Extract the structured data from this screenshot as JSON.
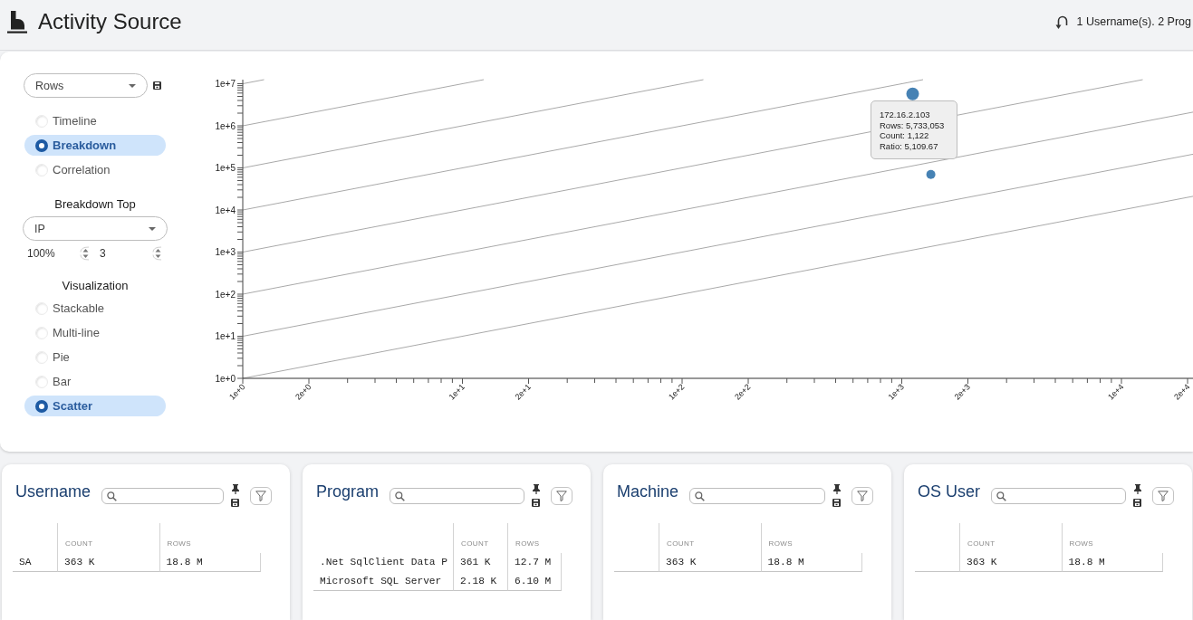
{
  "header": {
    "title": "Activity Source",
    "summary": "1 Username(s). 2 Prog"
  },
  "controls": {
    "metric_dropdown": {
      "value": "Rows"
    },
    "modes": [
      {
        "label": "Timeline",
        "selected": false
      },
      {
        "label": "Breakdown",
        "selected": true
      },
      {
        "label": "Correlation",
        "selected": false
      }
    ],
    "breakdown_top": {
      "label": "Breakdown Top",
      "dropdown_value": "IP",
      "percent": "100%",
      "count": "3"
    },
    "visualization": {
      "label": "Visualization",
      "options": [
        {
          "label": "Stackable",
          "selected": false
        },
        {
          "label": "Multi-line",
          "selected": false
        },
        {
          "label": "Pie",
          "selected": false
        },
        {
          "label": "Bar",
          "selected": false
        },
        {
          "label": "Scatter",
          "selected": true
        }
      ]
    }
  },
  "scatter_chart": {
    "y_axis": {
      "labels": [
        "1e+7",
        "1e+6",
        "1e+5",
        "1e+4",
        "1e+3",
        "1e+2",
        "1e+1",
        "1e+0"
      ]
    },
    "x_axis": {
      "labels": [
        "1e+0",
        "2e+0",
        "1e+1",
        "2e+1",
        "1e+2",
        "2e+2",
        "1e+3",
        "2e+3",
        "1e+4",
        "2e+4"
      ]
    },
    "points": [
      {
        "hovered": true
      },
      {
        "hovered": false
      }
    ],
    "tooltip": {
      "lines": [
        "172.16.2.103",
        "Rows: 5,733,053",
        "Count: 1,122",
        "Ratio: 5,109.67"
      ]
    }
  },
  "panels": [
    {
      "title": "Username",
      "columns": [
        "COUNT",
        "ROWS"
      ],
      "rows": [
        {
          "name": "SA",
          "values": [
            "363 K",
            "18.8 M"
          ]
        }
      ]
    },
    {
      "title": "Program",
      "columns": [
        "COUNT",
        "ROWS"
      ],
      "rows": [
        {
          "name": ".Net SqlClient Data P",
          "values": [
            "361 K",
            "12.7 M"
          ]
        },
        {
          "name": "Microsoft SQL Server",
          "values": [
            "2.18 K",
            "6.10 M"
          ]
        }
      ]
    },
    {
      "title": "Machine",
      "columns": [
        "COUNT",
        "ROWS"
      ],
      "rows": [
        {
          "values": [
            "363 K",
            "18.8 M"
          ]
        }
      ]
    },
    {
      "title": "OS User",
      "columns": [
        "COUNT",
        "ROWS"
      ],
      "rows": [
        {
          "values": [
            "363 K",
            "18.8 M"
          ]
        }
      ]
    }
  ]
}
